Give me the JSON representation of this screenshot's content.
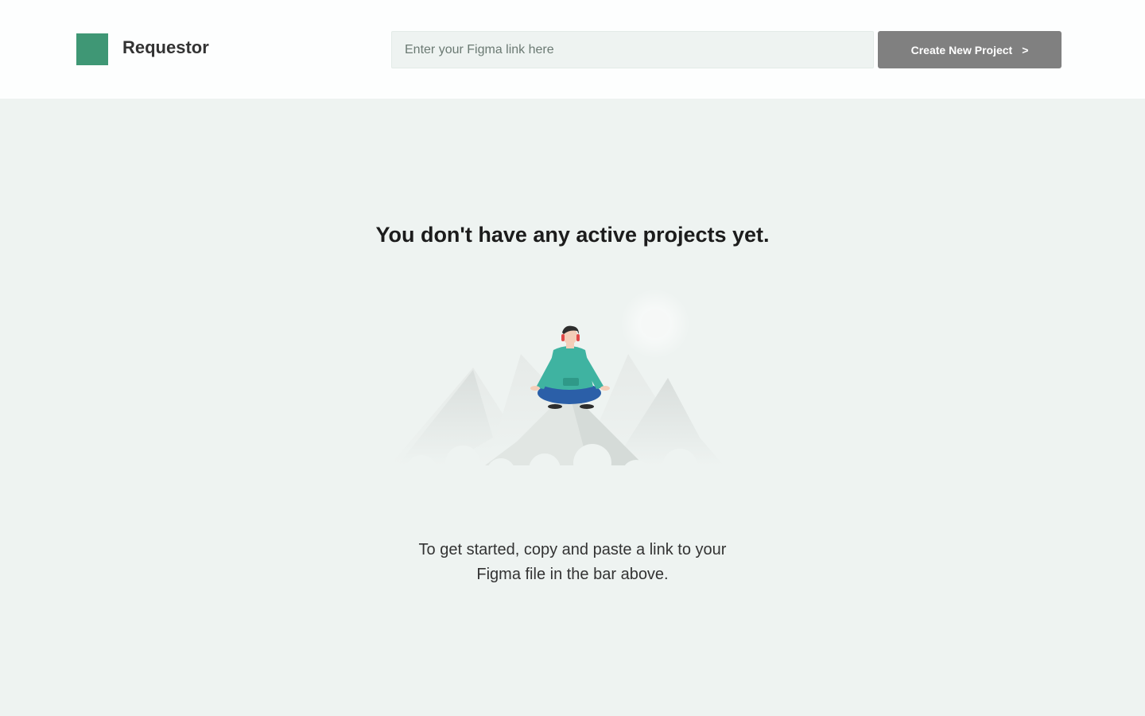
{
  "header": {
    "app_title": "Requestor",
    "logo_color": "#3f9775",
    "link_input": {
      "value": "",
      "placeholder": "Enter your Figma link here"
    },
    "create_button": {
      "label": "Create New Project",
      "chevron": ">"
    }
  },
  "empty_state": {
    "heading": "You don't have any active projects yet.",
    "illustration_icon": "meditating-person-on-mountains-illustration",
    "description_lines": [
      "To get started, copy and paste a link to your",
      "Figma file in the bar above."
    ]
  },
  "colors": {
    "accent": "#3f9775",
    "button": "#808080",
    "background": "#eef3f1"
  }
}
